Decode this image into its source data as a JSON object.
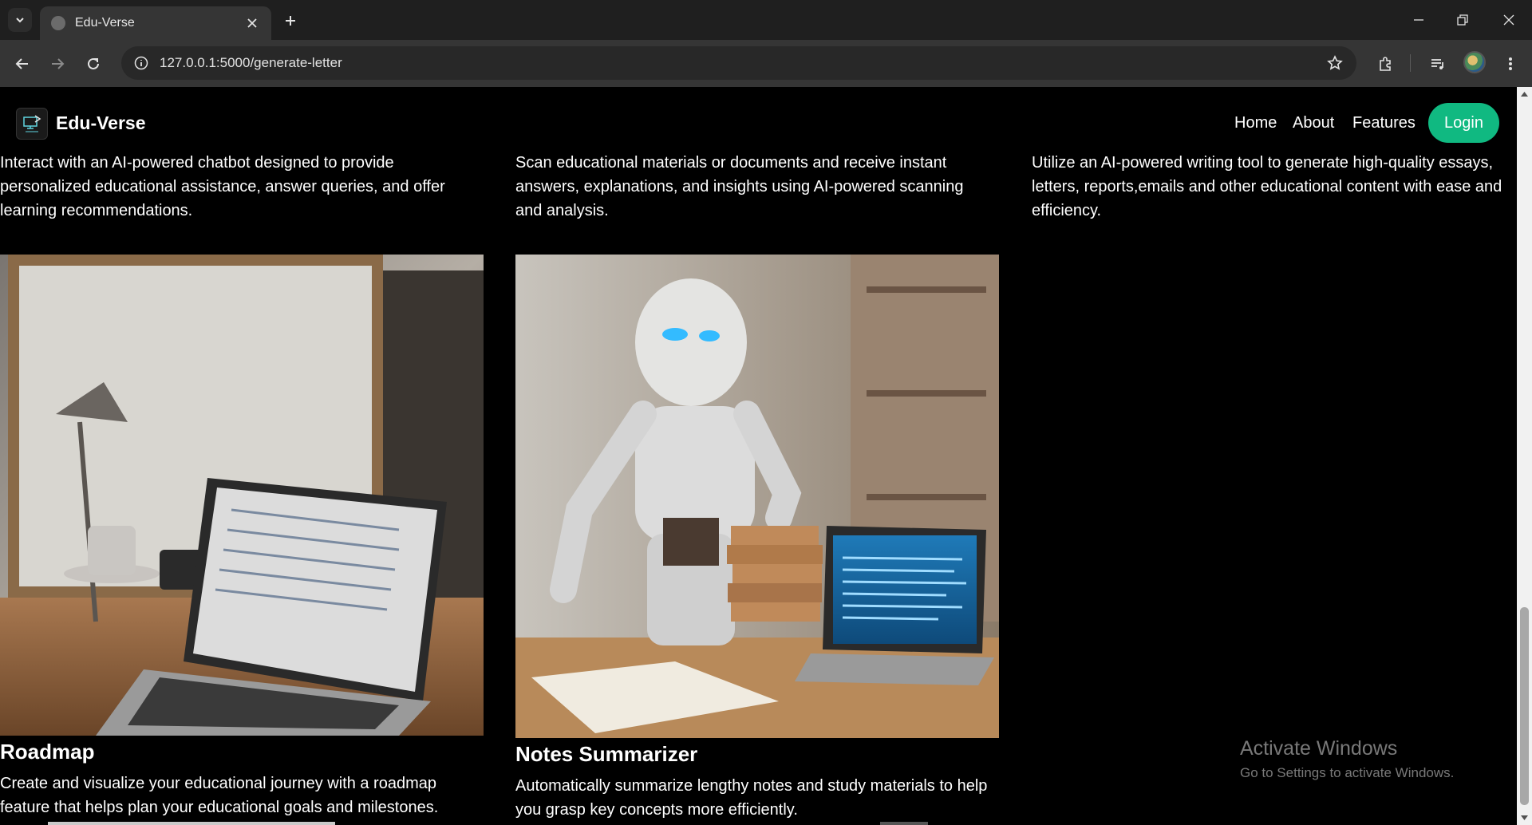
{
  "browser": {
    "tab_title": "Edu-Verse",
    "url": "127.0.0.1:5000/generate-letter"
  },
  "site": {
    "brand": "Edu-Verse",
    "nav": [
      "Home",
      "About",
      "Features"
    ],
    "login_label": "Login"
  },
  "features": {
    "chatbot_desc": "Interact with an AI-powered chatbot designed to provide personalized educational assistance, answer queries, and offer learning recommendations.",
    "scanner_desc": "Scan educational materials or documents and receive instant answers, explanations, and insights using AI-powered scanning and analysis.",
    "writer_desc": "Utilize an AI-powered writing tool to generate high-quality essays, letters, reports,emails and other educational content with ease and efficiency.",
    "roadmap": {
      "title": "Roadmap",
      "desc": "Create and visualize your educational journey with a roadmap feature that helps plan your educational goals and milestones."
    },
    "summarizer": {
      "title": "Notes Summarizer",
      "desc": "Automatically summarize lengthy notes and study materials to help you grasp key concepts more efficiently."
    }
  },
  "watermark": {
    "line1": "Activate Windows",
    "line2": "Go to Settings to activate Windows."
  },
  "colors": {
    "accent": "#10b981",
    "page_bg": "#000000",
    "chrome_bg": "#1f1f1f"
  }
}
